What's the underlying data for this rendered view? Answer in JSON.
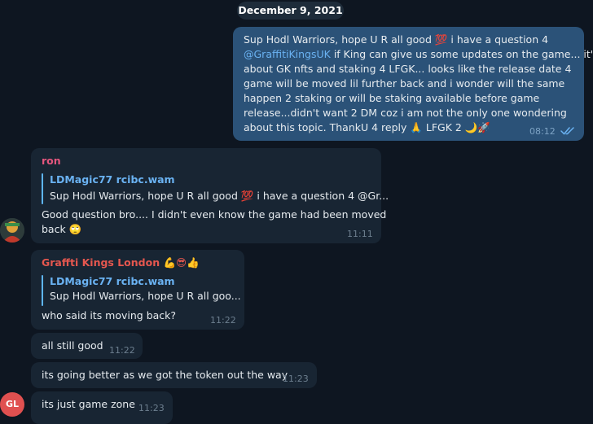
{
  "date_separator": "December 9, 2021",
  "colors": {
    "background": "#0e1621",
    "incoming_bubble": "#182533",
    "outgoing_bubble": "#2b5278",
    "mention": "#6ab2f2",
    "sender_ron": "#e4567e",
    "sender_graffiti": "#e5574f",
    "avatar_gl": "#e05050"
  },
  "messages": [
    {
      "direction": "outgoing",
      "lines": [
        "Sup Hodl Warriors, hope U R all good 💯 i have a question 4",
        "if King can give us some updates on the game... it's",
        "about GK nfts and staking 4 LFGK... looks like the release date 4",
        "game will be moved lil further back and i wonder will the same",
        "happen 2 staking or will be staking available before game",
        "release...didn't want 2 DM coz i am not the only one wondering",
        "about this topic. ThankU 4 reply 🙏 LFGK 2 🌙🚀"
      ],
      "mention": "@GraffitiKingsUK",
      "time": "08:12",
      "status_icon": "double-check-icon"
    },
    {
      "direction": "incoming",
      "sender": "ron",
      "reply": {
        "name": "LDMagic77 rcibc.wam",
        "text": "Sup Hodl Warriors, hope U R all good 💯 i have a question 4 @Gr..."
      },
      "lines": [
        "Good question bro.... I didn't even know the game had been moved",
        "back 🙄"
      ],
      "time": "11:11"
    },
    {
      "direction": "incoming",
      "sender": "Graffti Kings London 💪😎👍",
      "reply": {
        "name": "LDMagic77 rcibc.wam",
        "text": "Sup Hodl Warriors, hope U R all goo..."
      },
      "text": "who said its moving back?",
      "time": "11:22"
    },
    {
      "direction": "incoming",
      "text": "all still good",
      "time": "11:22"
    },
    {
      "direction": "incoming",
      "text": "its going better as we got the token out the way",
      "time": "11:23"
    },
    {
      "direction": "incoming",
      "text": "its just game zone",
      "time": "11:23"
    }
  ],
  "avatars": {
    "ron": "ron-avatar",
    "graffiti_initials": "GL"
  }
}
